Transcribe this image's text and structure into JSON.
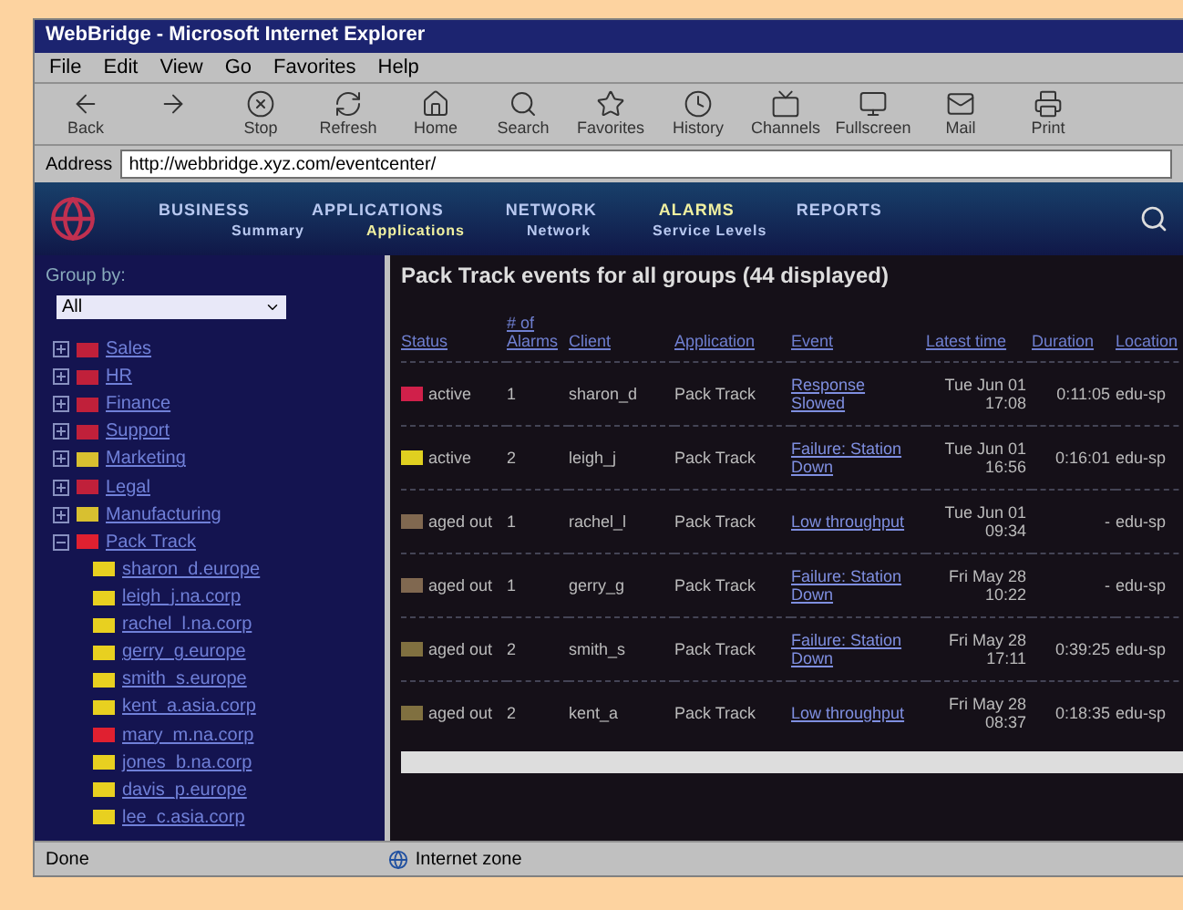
{
  "window": {
    "title": "WebBridge - Microsoft Internet Explorer"
  },
  "menu": [
    "File",
    "Edit",
    "View",
    "Go",
    "Favorites",
    "Help"
  ],
  "toolbar": [
    {
      "kind": "labeled",
      "label": "Back"
    },
    {
      "kind": "bare"
    },
    {
      "kind": "labeled",
      "label": "Stop"
    },
    {
      "kind": "labeled",
      "label": "Refresh"
    },
    {
      "kind": "labeled",
      "label": "Home"
    },
    {
      "kind": "labeled",
      "label": "Search"
    },
    {
      "kind": "labeled",
      "label": "Favorites"
    },
    {
      "kind": "labeled",
      "label": "History"
    },
    {
      "kind": "labeled",
      "label": "Channels"
    },
    {
      "kind": "labeled",
      "label": "Fullscreen"
    },
    {
      "kind": "labeled",
      "label": "Mail"
    },
    {
      "kind": "labeled",
      "label": "Print"
    }
  ],
  "address": {
    "label": "Address",
    "value": "http://webbridge.xyz.com/eventcenter/"
  },
  "nav": [
    {
      "label": "BUSINESS",
      "selected": false
    },
    {
      "label": "APPLICATIONS",
      "selected": false
    },
    {
      "label": "NETWORK",
      "selected": false
    },
    {
      "label": "ALARMS",
      "selected": true
    },
    {
      "label": "REPORTS",
      "selected": false
    }
  ],
  "subnav": [
    {
      "label": "Summary",
      "selected": false
    },
    {
      "label": "Applications",
      "selected": true
    },
    {
      "label": "Network",
      "selected": false
    },
    {
      "label": "Service Levels",
      "selected": false
    }
  ],
  "sidebar": {
    "label": "Group by:",
    "select": "All",
    "items": [
      {
        "label": "Sales",
        "color": "#c0203a",
        "expanded": false
      },
      {
        "label": "HR",
        "color": "#c0203a",
        "expanded": false
      },
      {
        "label": "Finance",
        "color": "#c0203a",
        "expanded": false
      },
      {
        "label": "Support",
        "color": "#c0203a",
        "expanded": false
      },
      {
        "label": "Marketing",
        "color": "#d8c030",
        "expanded": false
      },
      {
        "label": "Legal",
        "color": "#c0203a",
        "expanded": false
      },
      {
        "label": "Manufacturing",
        "color": "#d8c030",
        "expanded": false
      },
      {
        "label": "Pack Track",
        "color": "#e02030",
        "expanded": true,
        "children": [
          {
            "label": "sharon_d.europe",
            "color": "#e8d020"
          },
          {
            "label": "leigh_j.na.corp",
            "color": "#e8d020"
          },
          {
            "label": "rachel_l.na.corp",
            "color": "#e8d020"
          },
          {
            "label": "gerry_g.europe",
            "color": "#e8d020"
          },
          {
            "label": "smith_s.europe",
            "color": "#e8d020"
          },
          {
            "label": "kent_a.asia.corp",
            "color": "#e8d020"
          },
          {
            "label": "mary_m.na.corp",
            "color": "#e02030"
          },
          {
            "label": "jones_b.na.corp",
            "color": "#e8d020"
          },
          {
            "label": "davis_p.europe",
            "color": "#e8d020"
          },
          {
            "label": "lee_c.asia.corp",
            "color": "#e8d020"
          }
        ]
      }
    ]
  },
  "main": {
    "title": "Pack Track events for all groups (44 displayed)",
    "columns": [
      {
        "label": "Status"
      },
      {
        "label": "Alarms",
        "sub": "# of"
      },
      {
        "label": "Client"
      },
      {
        "label": "Application"
      },
      {
        "label": "Event"
      },
      {
        "label": "Latest time"
      },
      {
        "label": "Duration"
      },
      {
        "label": "Location"
      }
    ],
    "rows": [
      {
        "status": "active",
        "color": "#d0204a",
        "alarms": "1",
        "client": "sharon_d",
        "application": "Pack Track",
        "event": "Response Slowed",
        "time": "Tue Jun 01 17:08",
        "duration": "0:11:05",
        "location": "edu-sp"
      },
      {
        "status": "active",
        "color": "#e0d020",
        "alarms": "2",
        "client": "leigh_j",
        "application": "Pack Track",
        "event": "Failure: Station Down",
        "time": "Tue Jun 01 16:56",
        "duration": "0:16:01",
        "location": "edu-sp"
      },
      {
        "status": "aged out",
        "color": "#806850",
        "alarms": "1",
        "client": "rachel_l",
        "application": "Pack Track",
        "event": "Low throughput",
        "time": "Tue Jun 01 09:34",
        "duration": "-",
        "location": "edu-sp"
      },
      {
        "status": "aged out",
        "color": "#806850",
        "alarms": "1",
        "client": "gerry_g",
        "application": "Pack Track",
        "event": "Failure: Station Down",
        "time": "Fri May 28 10:22",
        "duration": "-",
        "location": "edu-sp"
      },
      {
        "status": "aged out",
        "color": "#807040",
        "alarms": "2",
        "client": "smith_s",
        "application": "Pack Track",
        "event": "Failure: Station Down",
        "time": "Fri May 28 17:11",
        "duration": "0:39:25",
        "location": "edu-sp"
      },
      {
        "status": "aged out",
        "color": "#807040",
        "alarms": "2",
        "client": "kent_a",
        "application": "Pack Track",
        "event": "Low throughput",
        "time": "Fri May 28 08:37",
        "duration": "0:18:35",
        "location": "edu-sp"
      }
    ]
  },
  "status_bar": {
    "left": "Done",
    "zone": "Internet zone"
  }
}
